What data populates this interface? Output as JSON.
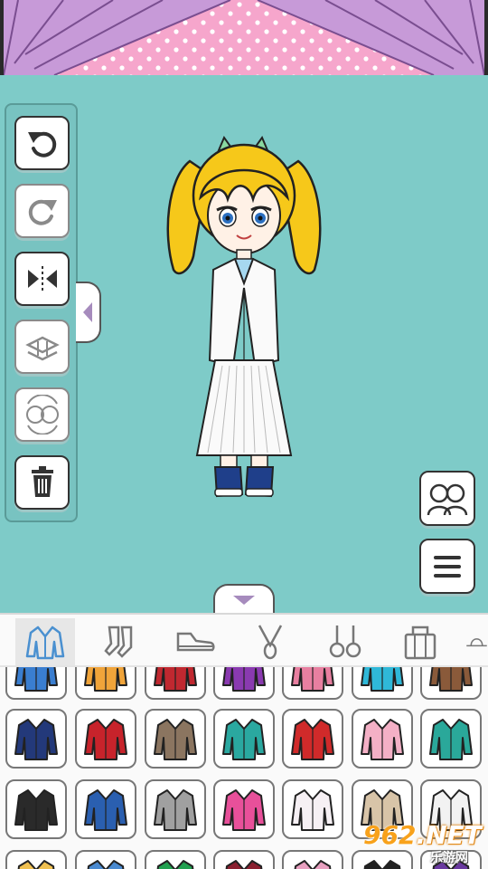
{
  "toolbar": {
    "buttons": [
      {
        "icon": "undo-icon",
        "enabled": true
      },
      {
        "icon": "redo-icon",
        "enabled": false
      },
      {
        "icon": "flip-icon",
        "enabled": true
      },
      {
        "icon": "layer-swap-icon",
        "enabled": false
      },
      {
        "icon": "swap-character-icon",
        "enabled": false
      },
      {
        "icon": "trash-icon",
        "enabled": true
      }
    ]
  },
  "right_buttons": [
    {
      "icon": "characters-icon"
    },
    {
      "icon": "menu-icon"
    }
  ],
  "categories": [
    {
      "icon": "jacket-icon",
      "active": true
    },
    {
      "icon": "socks-icon",
      "active": false
    },
    {
      "icon": "shoe-icon",
      "active": false
    },
    {
      "icon": "necklace-icon",
      "active": false
    },
    {
      "icon": "earrings-icon",
      "active": false
    },
    {
      "icon": "bag-icon",
      "active": false
    },
    {
      "icon": "hat-icon",
      "active": false
    }
  ],
  "clothing_rows": [
    {
      "items": [
        {
          "name": "blue-jacket",
          "color": "#3a7ed0"
        },
        {
          "name": "orange-coat",
          "color": "#f0a43a"
        },
        {
          "name": "red-coat",
          "color": "#c02830"
        },
        {
          "name": "purple-cardigan",
          "color": "#8a3ab0"
        },
        {
          "name": "pink-black-jacket",
          "color": "#e87fa0"
        },
        {
          "name": "teal-raincoat",
          "color": "#2fb8d8"
        },
        {
          "name": "brown-coat",
          "color": "#8a5a3a"
        }
      ]
    },
    {
      "items": [
        {
          "name": "navy-sweater",
          "color": "#23397a"
        },
        {
          "name": "red-blazer",
          "color": "#c7232b"
        },
        {
          "name": "plaid-coat",
          "color": "#8b7560"
        },
        {
          "name": "teal-coat",
          "color": "#2aa8a0"
        },
        {
          "name": "red-black-coat",
          "color": "#d02a2a"
        },
        {
          "name": "pink-bomber",
          "color": "#f4b0c6"
        },
        {
          "name": "teal-varsity",
          "color": "#2aa89a"
        }
      ]
    },
    {
      "items": [
        {
          "name": "patch-jacket",
          "color": "#2a2a2a"
        },
        {
          "name": "blue-cardigan",
          "color": "#2a5fb0"
        },
        {
          "name": "grey-cardigan",
          "color": "#a0a0a0"
        },
        {
          "name": "pink-sweater",
          "color": "#e8509a"
        },
        {
          "name": "pastel-hoodie",
          "color": "#f6f0f4"
        },
        {
          "name": "beige-trench",
          "color": "#d8c4a8"
        },
        {
          "name": "white-blazer",
          "color": "#f2f2f2"
        }
      ]
    },
    {
      "items": [
        {
          "name": "yellow-top",
          "color": "#f0c050"
        },
        {
          "name": "blue-top",
          "color": "#4a8ad0"
        },
        {
          "name": "green-top",
          "color": "#22a050"
        },
        {
          "name": "dark-red-top",
          "color": "#8a2030"
        },
        {
          "name": "pink-top",
          "color": "#e8a0c0"
        },
        {
          "name": "black-top",
          "color": "#222222"
        },
        {
          "name": "purple-top",
          "color": "#6a3aa0"
        }
      ]
    }
  ],
  "watermark": {
    "number": "962",
    "suffix": ".NET",
    "sub": "乐游网"
  }
}
